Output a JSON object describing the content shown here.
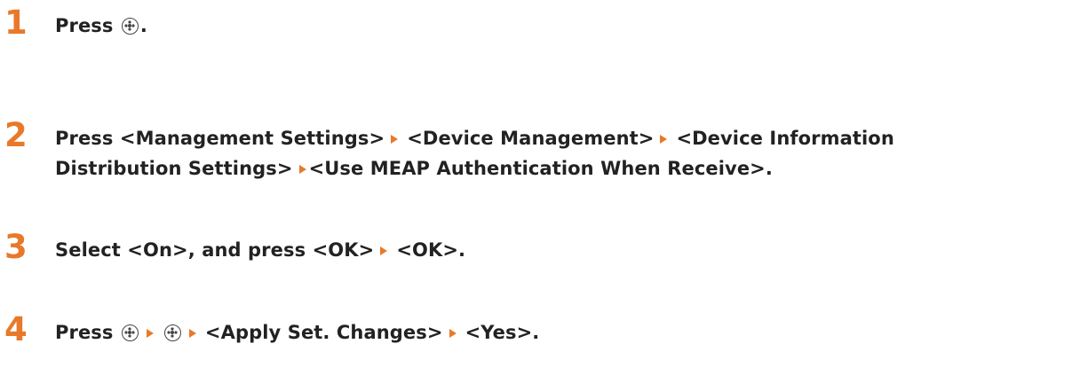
{
  "steps": [
    {
      "number": "1",
      "parts": [
        "Press ",
        "."
      ]
    },
    {
      "number": "2",
      "parts": [
        "Press <Management Settings>",
        "<Device Management>",
        "<Device Information",
        "Distribution Settings>",
        "<Use MEAP Authentication When Receive>."
      ]
    },
    {
      "number": "3",
      "parts": [
        "Select <On>, and press <OK>",
        "<OK>."
      ]
    },
    {
      "number": "4",
      "parts": [
        "Press ",
        "<Apply Set. Changes>",
        "<Yes>."
      ]
    }
  ],
  "icons": {
    "home_key": "home-key-icon",
    "step_arrow": "arrow-right-icon",
    "accent_color": "#e8792a"
  }
}
